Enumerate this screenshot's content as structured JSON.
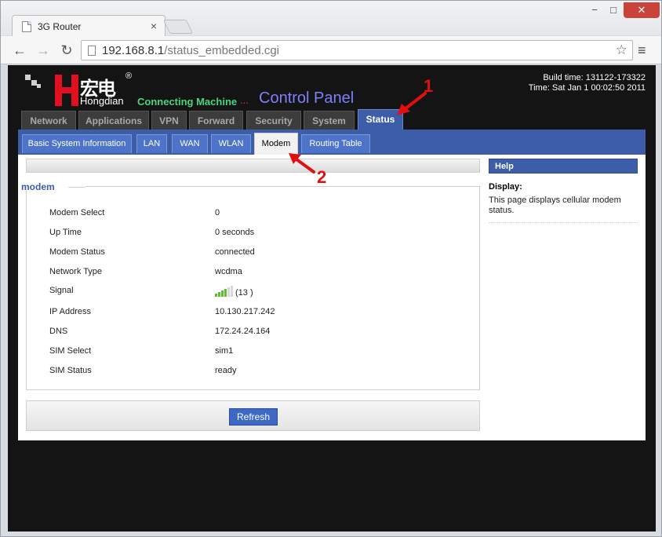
{
  "browser": {
    "tab_title": "3G Router",
    "tab_close": "×",
    "win_min": "−",
    "win_max": "□",
    "win_close": "✕",
    "back": "←",
    "forward": "→",
    "reload": "↻",
    "url_host": "192.168.8.1",
    "url_path": "/status_embedded.cgi",
    "star": "☆",
    "menu": "≡"
  },
  "header": {
    "brand_cn": "宏电",
    "brand_reg": "®",
    "brand_en": "Hongdian",
    "slogan": "Connecting Machine",
    "slogan_dots": "...",
    "panel_title": "Control Panel",
    "build_time": "Build time: 131122-173322",
    "current_time": "Time: Sat Jan 1 00:02:50 2011"
  },
  "main_tabs": [
    {
      "label": "Network"
    },
    {
      "label": "Applications"
    },
    {
      "label": "VPN"
    },
    {
      "label": "Forward"
    },
    {
      "label": "Security"
    },
    {
      "label": "System"
    },
    {
      "label": "Status"
    }
  ],
  "sub_tabs": [
    {
      "label": "Basic System Information"
    },
    {
      "label": "LAN"
    },
    {
      "label": "WAN"
    },
    {
      "label": "WLAN"
    },
    {
      "label": "Modem"
    },
    {
      "label": "Routing Table"
    }
  ],
  "section": {
    "title": "modem"
  },
  "modem": [
    {
      "key": "Modem Select",
      "value": "0"
    },
    {
      "key": "Up Time",
      "value": "0 seconds"
    },
    {
      "key": "Modem Status",
      "value": "connected"
    },
    {
      "key": "Network Type",
      "value": "wcdma"
    },
    {
      "key": "Signal",
      "value": "(13 )"
    },
    {
      "key": "IP Address",
      "value": "10.130.217.242"
    },
    {
      "key": "DNS",
      "value": "172.24.24.164"
    },
    {
      "key": "SIM Select",
      "value": "sim1"
    },
    {
      "key": "SIM Status",
      "value": "ready"
    }
  ],
  "signal_level": {
    "bars_on": 4,
    "bars_total": 6
  },
  "refresh_label": "Refresh",
  "help": {
    "header": "Help",
    "title": "Display:",
    "text": "This page displays cellular modem status."
  },
  "annotations": {
    "arrow1_label": "1",
    "arrow2_label": "2",
    "color": "#e01010"
  }
}
